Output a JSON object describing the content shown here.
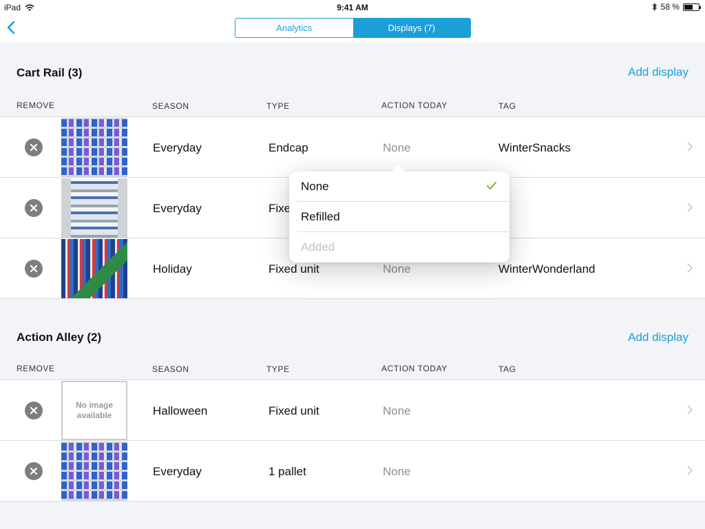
{
  "status_bar": {
    "device": "iPad",
    "time": "9:41 AM",
    "battery": "58 %",
    "battery_fraction": 0.58
  },
  "nav": {
    "back_icon": "chevron-left-icon",
    "tabs": [
      {
        "label": "Analytics",
        "active": false
      },
      {
        "label": "Displays (7)",
        "active": true
      }
    ]
  },
  "columns": {
    "remove": "REMOVE",
    "season": "SEASON",
    "type": "TYPE",
    "action": "ACTION TODAY",
    "tag": "TAG"
  },
  "sections": [
    {
      "title": "Cart Rail (3)",
      "add_label": "Add display",
      "rows": [
        {
          "image": "shelf-photo",
          "season": "Everyday",
          "type": "Endcap",
          "action": "None",
          "tag": "WinterSnacks"
        },
        {
          "image": "shelf-photo",
          "season": "Everyday",
          "type": "Fixe",
          "action": "",
          "tag": ""
        },
        {
          "image": "holiday-shelf-photo",
          "season": "Holiday",
          "type": "Fixed unit",
          "action": "None",
          "tag": "WinterWonderland"
        }
      ]
    },
    {
      "title": "Action Alley (2)",
      "add_label": "Add display",
      "rows": [
        {
          "image": "no-image",
          "image_text": "No image available",
          "season": "Halloween",
          "type": "Fixed unit",
          "action": "None",
          "tag": ""
        },
        {
          "image": "shelf-photo",
          "season": "Everyday",
          "type": "1 pallet",
          "action": "None",
          "tag": ""
        }
      ]
    }
  ],
  "popover": {
    "options": [
      {
        "label": "None",
        "selected": true,
        "enabled": true
      },
      {
        "label": "Refilled",
        "selected": false,
        "enabled": true
      },
      {
        "label": "Added",
        "selected": false,
        "enabled": false
      }
    ]
  },
  "colors": {
    "accent": "#1a9fd9",
    "check": "#7cb82f",
    "muted": "#8e8e93"
  }
}
